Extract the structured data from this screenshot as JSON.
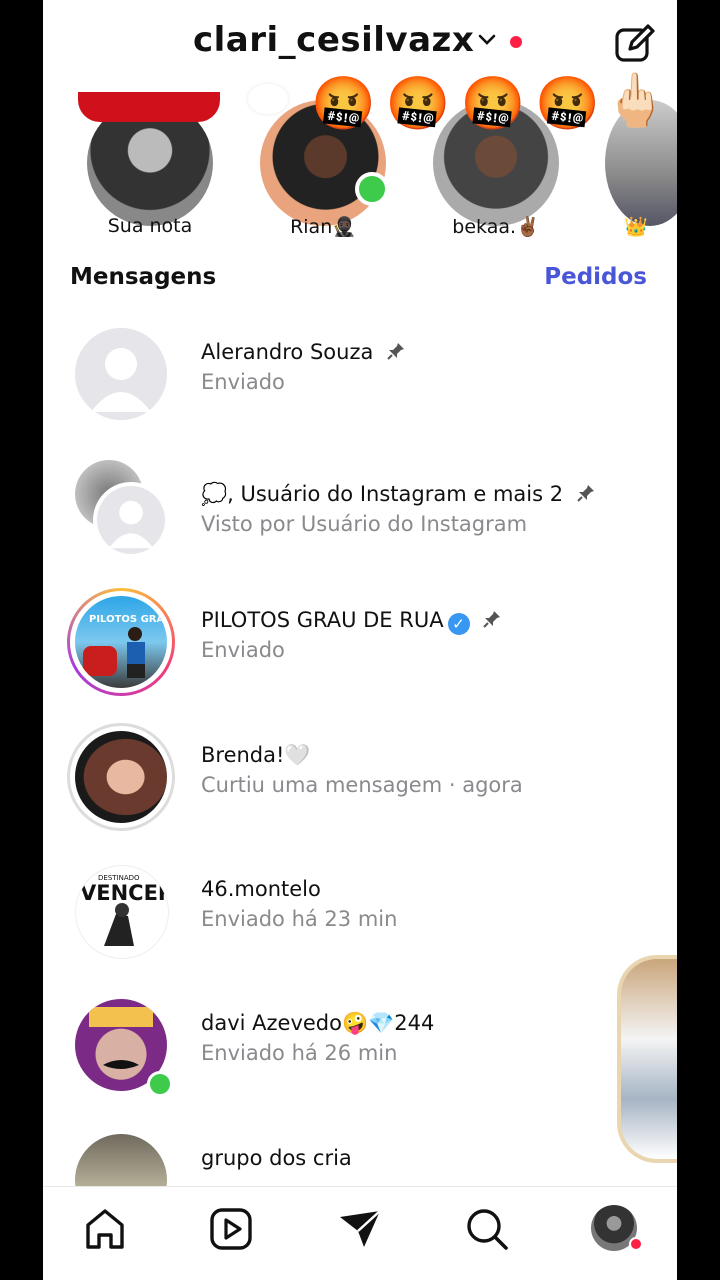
{
  "header": {
    "username": "clari_cesilvazx"
  },
  "notes": [
    {
      "label": "Sua nota"
    },
    {
      "label": "Rian🥷🏿"
    },
    {
      "label": "bekaa.✌🏾"
    },
    {
      "label": "👑"
    }
  ],
  "sticker_emojis": "🤬🤬🤬🤬",
  "middle_finger": "🖕🏻",
  "section": {
    "title": "Mensagens",
    "requests": "Pedidos"
  },
  "threads": [
    {
      "name": "Alerandro Souza",
      "status": "Enviado",
      "pinned": true
    },
    {
      "name": "💭, Usuário do Instagram e mais 2",
      "status": "Visto por Usuário do Instagram",
      "pinned": true
    },
    {
      "name": "PILOTOS GRAU DE RUA",
      "status": "Enviado",
      "pinned": true,
      "verified": true
    },
    {
      "name": "Brenda!🤍",
      "status": "Curtiu uma mensagem · agora"
    },
    {
      "name": "46.montelo",
      "status": "Enviado há 23 min"
    },
    {
      "name": "davi Azevedo🤪💎244",
      "status": "Enviado há 26 min"
    },
    {
      "name": "grupo dos cria",
      "status": ""
    }
  ],
  "avatar_texts": {
    "pilotos": "PILOTOS GRAU DE RUA",
    "vencer": "VENCER",
    "destinado": "DESTINADO"
  },
  "colors": {
    "accent": "#4a56d8",
    "online": "#3ecb4c",
    "notification": "#ff1f45",
    "verified": "#3897f0"
  }
}
